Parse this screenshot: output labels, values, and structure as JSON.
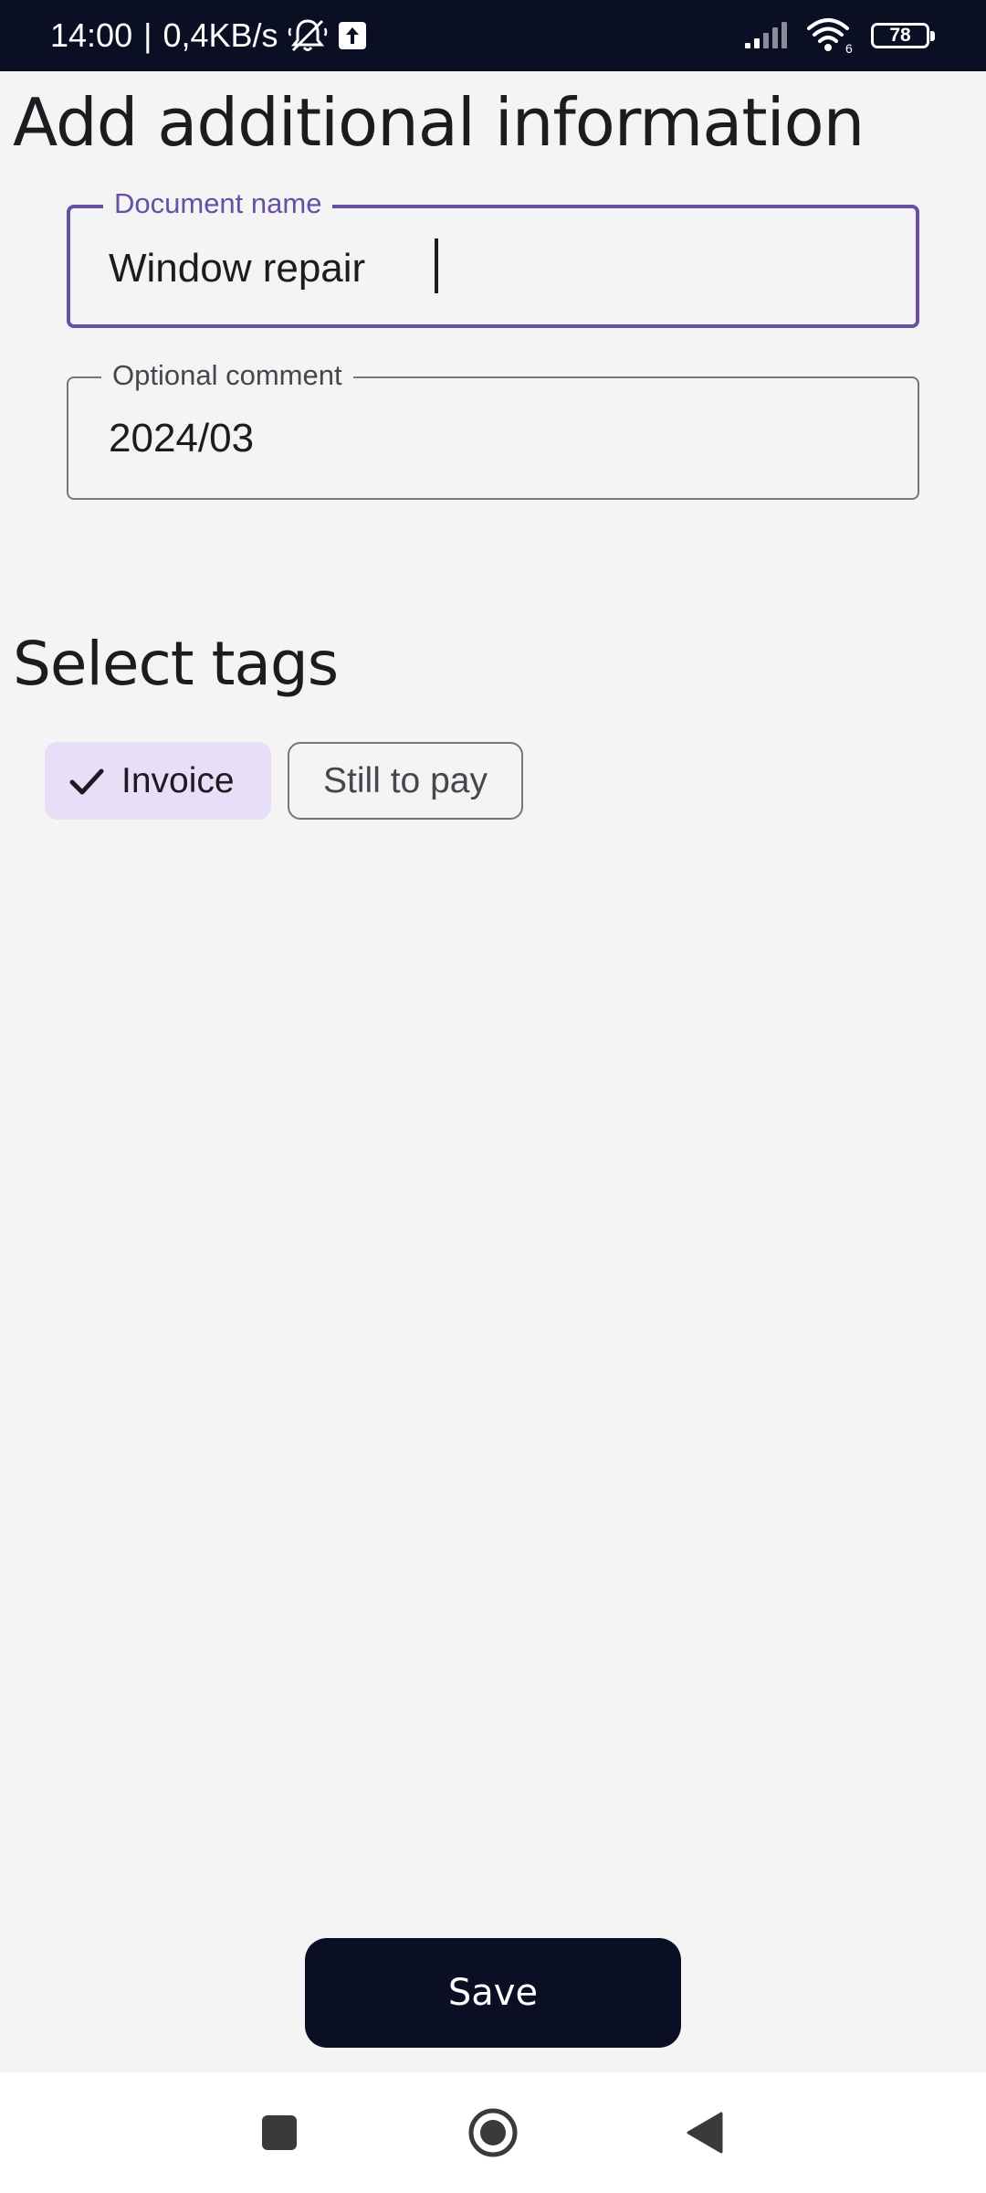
{
  "status_bar": {
    "time": "14:00",
    "separator": "|",
    "network_speed": "0,4KB/s",
    "battery_level": "78",
    "signal_network_type": "6",
    "icons": [
      "bell-off-icon",
      "upload-icon",
      "signal-icon",
      "wifi-icon",
      "battery-icon"
    ]
  },
  "header": {
    "title": "Add additional information"
  },
  "form": {
    "document_name": {
      "label": "Document name",
      "value": "Window repair",
      "focused": true
    },
    "optional_comment": {
      "label": "Optional comment",
      "value": "2024/03"
    }
  },
  "tags": {
    "title": "Select tags",
    "items": [
      {
        "label": "Invoice",
        "selected": true,
        "icon": "check-icon"
      },
      {
        "label": "Still to pay",
        "selected": false
      }
    ]
  },
  "actions": {
    "save_label": "Save"
  },
  "nav_bar": {
    "icons": [
      "recent-apps-icon",
      "home-icon",
      "back-icon"
    ]
  },
  "colors": {
    "status_bar_bg": "#0b0f24",
    "background": "#f4f4f5",
    "accent": "#6750a4",
    "chip_selected_bg": "#e8def8",
    "save_button_bg": "#0b0f24"
  }
}
